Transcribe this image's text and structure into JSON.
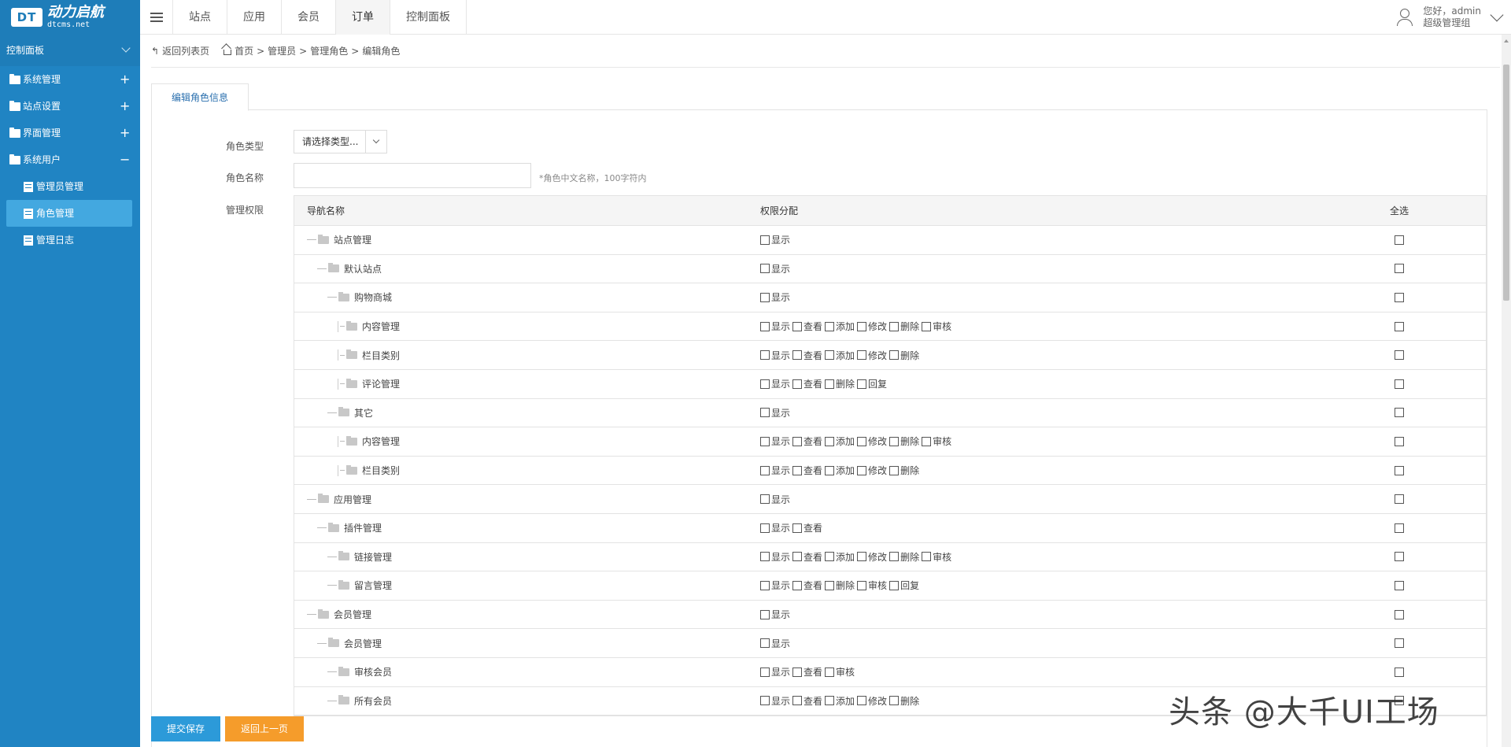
{
  "logo": {
    "box": "DT",
    "cn": "动力启航",
    "en": "dtcms.net"
  },
  "nav": [
    "站点",
    "应用",
    "会员",
    "订单",
    "控制面板"
  ],
  "nav_active": 3,
  "user": {
    "greeting": "您好，admin",
    "role": "超级管理组"
  },
  "sidebar": {
    "title": "控制面板",
    "groups": [
      {
        "label": "系统管理",
        "sign": "+"
      },
      {
        "label": "站点设置",
        "sign": "+"
      },
      {
        "label": "界面管理",
        "sign": "+"
      },
      {
        "label": "系统用户",
        "sign": "−"
      }
    ],
    "subitems": [
      "管理员管理",
      "角色管理",
      "管理日志"
    ],
    "active_sub": 1
  },
  "breadcrumb": {
    "back": "返回列表页",
    "home": "首页",
    "p1": "管理员",
    "p2": "管理角色",
    "p3": "编辑角色"
  },
  "tab": "编辑角色信息",
  "form": {
    "type_label": "角色类型",
    "type_value": "请选择类型...",
    "name_label": "角色名称",
    "name_hint": "*角色中文名称，100字符内",
    "perm_label": "管理权限"
  },
  "table": {
    "headers": [
      "导航名称",
      "权限分配",
      "全选"
    ],
    "rows": [
      {
        "name": "站点管理",
        "level": 0,
        "perms": [
          "显示"
        ]
      },
      {
        "name": "默认站点",
        "level": 1,
        "perms": [
          "显示"
        ]
      },
      {
        "name": "购物商城",
        "level": 2,
        "perms": [
          "显示"
        ]
      },
      {
        "name": "内容管理",
        "level": 3,
        "perms": [
          "显示",
          "查看",
          "添加",
          "修改",
          "删除",
          "审核"
        ]
      },
      {
        "name": "栏目类别",
        "level": 3,
        "perms": [
          "显示",
          "查看",
          "添加",
          "修改",
          "删除"
        ]
      },
      {
        "name": "评论管理",
        "level": 3,
        "perms": [
          "显示",
          "查看",
          "删除",
          "回复"
        ]
      },
      {
        "name": "其它",
        "level": 2,
        "perms": [
          "显示"
        ]
      },
      {
        "name": "内容管理",
        "level": 3,
        "perms": [
          "显示",
          "查看",
          "添加",
          "修改",
          "删除",
          "审核"
        ]
      },
      {
        "name": "栏目类别",
        "level": 3,
        "perms": [
          "显示",
          "查看",
          "添加",
          "修改",
          "删除"
        ]
      },
      {
        "name": "应用管理",
        "level": 0,
        "perms": [
          "显示"
        ]
      },
      {
        "name": "插件管理",
        "level": 1,
        "perms": [
          "显示",
          "查看"
        ]
      },
      {
        "name": "链接管理",
        "level": 2,
        "perms": [
          "显示",
          "查看",
          "添加",
          "修改",
          "删除",
          "审核"
        ]
      },
      {
        "name": "留言管理",
        "level": 2,
        "perms": [
          "显示",
          "查看",
          "删除",
          "审核",
          "回复"
        ]
      },
      {
        "name": "会员管理",
        "level": 0,
        "perms": [
          "显示"
        ]
      },
      {
        "name": "会员管理",
        "level": 1,
        "perms": [
          "显示"
        ]
      },
      {
        "name": "审核会员",
        "level": 2,
        "perms": [
          "显示",
          "查看",
          "审核"
        ]
      },
      {
        "name": "所有会员",
        "level": 2,
        "perms": [
          "显示",
          "查看",
          "添加",
          "修改",
          "删除"
        ]
      }
    ]
  },
  "buttons": {
    "save": "提交保存",
    "back": "返回上一页"
  },
  "watermark": "头条 @大千UI工场"
}
